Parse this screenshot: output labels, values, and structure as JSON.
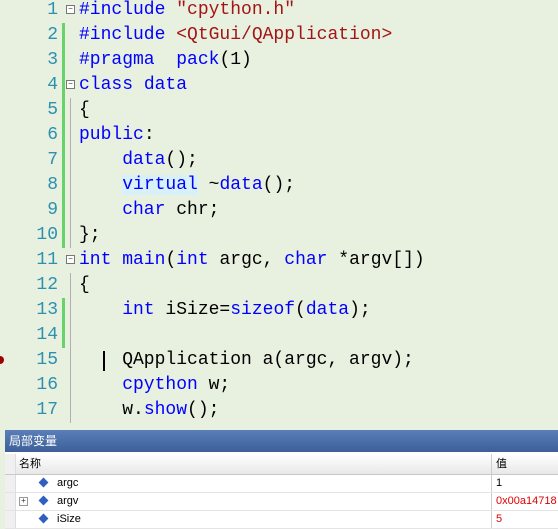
{
  "editor": {
    "lines": [
      {
        "n": "1",
        "tokens": [
          {
            "t": "#include ",
            "c": "pp"
          },
          {
            "t": "\"cpython.h\"",
            "c": "str"
          }
        ]
      },
      {
        "n": "2",
        "tokens": [
          {
            "t": "#include ",
            "c": "pp"
          },
          {
            "t": "<QtGui/QApplication>",
            "c": "str"
          }
        ]
      },
      {
        "n": "3",
        "tokens": [
          {
            "t": "#pragma  pack",
            "c": "pp"
          },
          {
            "t": "(1)",
            "c": ""
          }
        ]
      },
      {
        "n": "4",
        "tokens": [
          {
            "t": "class ",
            "c": "kw"
          },
          {
            "t": "data",
            "c": "kw"
          }
        ]
      },
      {
        "n": "5",
        "tokens": [
          {
            "t": "{",
            "c": ""
          }
        ]
      },
      {
        "n": "6",
        "tokens": [
          {
            "t": "public",
            "c": "kw"
          },
          {
            "t": ":",
            "c": ""
          }
        ]
      },
      {
        "n": "7",
        "tokens": [
          {
            "t": "    data",
            "c": "kw"
          },
          {
            "t": "();",
            "c": ""
          }
        ]
      },
      {
        "n": "8",
        "tokens": [
          {
            "t": "    ",
            "c": ""
          },
          {
            "t": "virtual",
            "c": "kw hl"
          },
          {
            "t": " ~",
            "c": ""
          },
          {
            "t": "data",
            "c": "kw"
          },
          {
            "t": "();",
            "c": ""
          }
        ]
      },
      {
        "n": "9",
        "tokens": [
          {
            "t": "    char ",
            "c": "kw"
          },
          {
            "t": "chr;",
            "c": ""
          }
        ]
      },
      {
        "n": "10",
        "tokens": [
          {
            "t": "};",
            "c": ""
          }
        ]
      },
      {
        "n": "11",
        "tokens": [
          {
            "t": "int ",
            "c": "kw"
          },
          {
            "t": "main",
            "c": "kw"
          },
          {
            "t": "(",
            "c": ""
          },
          {
            "t": "int ",
            "c": "kw"
          },
          {
            "t": "argc, ",
            "c": ""
          },
          {
            "t": "char ",
            "c": "kw"
          },
          {
            "t": "*argv[])",
            "c": ""
          }
        ]
      },
      {
        "n": "12",
        "tokens": [
          {
            "t": "{",
            "c": ""
          }
        ]
      },
      {
        "n": "13",
        "tokens": [
          {
            "t": "    int ",
            "c": "kw"
          },
          {
            "t": "iSize=",
            "c": ""
          },
          {
            "t": "sizeof",
            "c": "kw"
          },
          {
            "t": "(",
            "c": ""
          },
          {
            "t": "data",
            "c": "kw"
          },
          {
            "t": ");",
            "c": ""
          }
        ]
      },
      {
        "n": "14",
        "tokens": []
      },
      {
        "n": "15",
        "tokens": [
          {
            "t": "    QApplication a(argc, argv);",
            "c": ""
          }
        ]
      },
      {
        "n": "16",
        "tokens": [
          {
            "t": "    cpython ",
            "c": "kw"
          },
          {
            "t": "w;",
            "c": ""
          }
        ]
      },
      {
        "n": "17",
        "tokens": [
          {
            "t": "    w.",
            "c": ""
          },
          {
            "t": "show",
            "c": "kw"
          },
          {
            "t": "();",
            "c": ""
          }
        ]
      }
    ]
  },
  "locals": {
    "title": "局部变量",
    "col_name": "名称",
    "col_value": "值",
    "rows": [
      {
        "name": "argc",
        "value": "1",
        "changed": false,
        "expandable": false
      },
      {
        "name": "argv",
        "value": "0x00a14718",
        "changed": true,
        "expandable": true
      },
      {
        "name": "iSize",
        "value": "5",
        "changed": true,
        "expandable": false
      }
    ]
  }
}
